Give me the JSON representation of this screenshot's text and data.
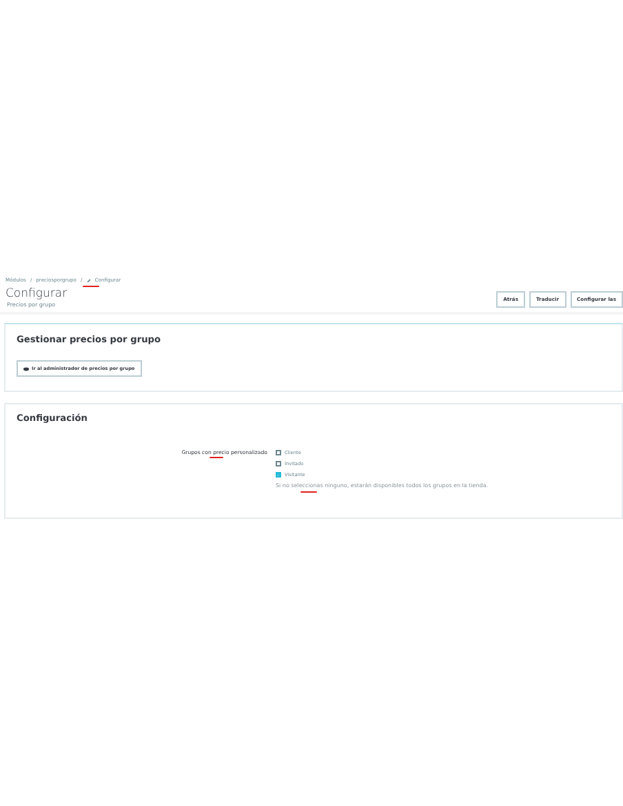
{
  "breadcrumb": {
    "items": [
      "Módulos",
      "preciosporgrupo"
    ],
    "separator": "/",
    "current": "Configurar"
  },
  "header": {
    "title": "Configurar",
    "subtitle": "Precios por grupo",
    "buttons": [
      "Atrás",
      "Traducir",
      "Configurar las"
    ]
  },
  "manage_panel": {
    "title": "Gestionar precios por grupo",
    "button": "Ir al administrador de precios por grupo"
  },
  "config_panel": {
    "title": "Configuración",
    "field_label": "Grupos con precio personalizado",
    "options": [
      {
        "label": "Cliente",
        "checked": false
      },
      {
        "label": "Invitado",
        "checked": false
      },
      {
        "label": "Visitante",
        "checked": true
      }
    ],
    "help": "Si no seleccionas ninguno, estarán disponibles todos los grupos en la tienda."
  }
}
